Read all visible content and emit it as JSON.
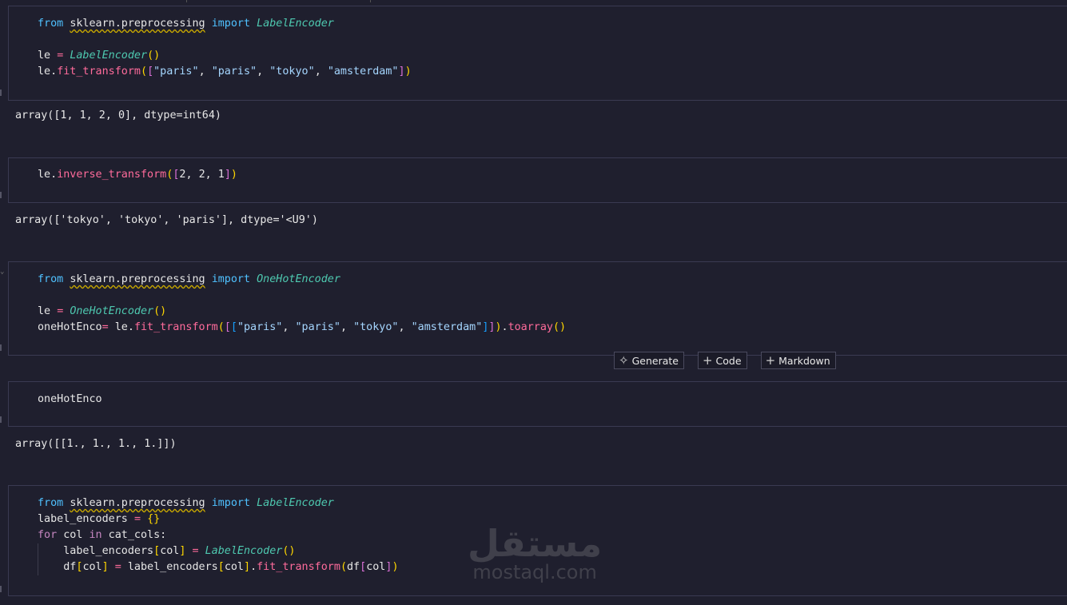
{
  "cells": [
    {
      "code": [
        [
          [
            "kw",
            "from"
          ],
          [
            "var",
            " "
          ],
          [
            "mod",
            "sklearn.preprocessing"
          ],
          [
            "var",
            " "
          ],
          [
            "kw",
            "import"
          ],
          [
            "var",
            " "
          ],
          [
            "cls",
            "LabelEncoder"
          ]
        ],
        [],
        [
          [
            "var",
            "le "
          ],
          [
            "op",
            "="
          ],
          [
            "var",
            " "
          ],
          [
            "cls",
            "LabelEncoder"
          ],
          [
            "br1",
            "()"
          ]
        ],
        [
          [
            "var",
            "le."
          ],
          [
            "fn",
            "fit_transform"
          ],
          [
            "br1",
            "("
          ],
          [
            "br2",
            "["
          ],
          [
            "str",
            "\"paris\""
          ],
          [
            "var",
            ", "
          ],
          [
            "str",
            "\"paris\""
          ],
          [
            "var",
            ", "
          ],
          [
            "str",
            "\"tokyo\""
          ],
          [
            "var",
            ", "
          ],
          [
            "str",
            "\"amsterdam\""
          ],
          [
            "br2",
            "]"
          ],
          [
            "br1",
            ")"
          ]
        ]
      ],
      "output": "array([1, 1, 2, 0], dtype=int64)"
    },
    {
      "code": [
        [
          [
            "var",
            "le."
          ],
          [
            "fn",
            "inverse_transform"
          ],
          [
            "br1",
            "("
          ],
          [
            "br2",
            "["
          ],
          [
            "num",
            "2"
          ],
          [
            "var",
            ", "
          ],
          [
            "num",
            "2"
          ],
          [
            "var",
            ", "
          ],
          [
            "num",
            "1"
          ],
          [
            "br2",
            "]"
          ],
          [
            "br1",
            ")"
          ]
        ]
      ],
      "output": "array(['tokyo', 'tokyo', 'paris'], dtype='<U9')"
    },
    {
      "code": [
        [
          [
            "kw",
            "from"
          ],
          [
            "var",
            " "
          ],
          [
            "mod",
            "sklearn.preprocessing"
          ],
          [
            "var",
            " "
          ],
          [
            "kw",
            "import"
          ],
          [
            "var",
            " "
          ],
          [
            "cls",
            "OneHotEncoder"
          ]
        ],
        [],
        [
          [
            "var",
            "le "
          ],
          [
            "op",
            "="
          ],
          [
            "var",
            " "
          ],
          [
            "cls",
            "OneHotEncoder"
          ],
          [
            "br1",
            "()"
          ]
        ],
        [
          [
            "var",
            "oneHotEnco"
          ],
          [
            "op",
            "="
          ],
          [
            "var",
            " le."
          ],
          [
            "fn",
            "fit_transform"
          ],
          [
            "br1",
            "("
          ],
          [
            "br2",
            "["
          ],
          [
            "br3",
            "["
          ],
          [
            "str",
            "\"paris\""
          ],
          [
            "var",
            ", "
          ],
          [
            "str",
            "\"paris\""
          ],
          [
            "var",
            ", "
          ],
          [
            "str",
            "\"tokyo\""
          ],
          [
            "var",
            ", "
          ],
          [
            "str",
            "\"amsterdam\""
          ],
          [
            "br3",
            "]"
          ],
          [
            "br2",
            "]"
          ],
          [
            "br1",
            ")"
          ],
          [
            "var",
            "."
          ],
          [
            "fn",
            "toarray"
          ],
          [
            "br1",
            "()"
          ]
        ]
      ],
      "output": ""
    },
    {
      "code": [
        [
          [
            "var",
            "oneHotEnco"
          ]
        ]
      ],
      "output": "array([[1., 1., 1., 1.]])"
    },
    {
      "code": [
        [
          [
            "kw",
            "from"
          ],
          [
            "var",
            " "
          ],
          [
            "mod",
            "sklearn.preprocessing"
          ],
          [
            "var",
            " "
          ],
          [
            "kw",
            "import"
          ],
          [
            "var",
            " "
          ],
          [
            "cls",
            "LabelEncoder"
          ]
        ],
        [
          [
            "var",
            "label_encoders "
          ],
          [
            "op",
            "="
          ],
          [
            "var",
            " "
          ],
          [
            "br1",
            "{}"
          ]
        ],
        [
          [
            "ctl",
            "for"
          ],
          [
            "var",
            " col "
          ],
          [
            "ctl",
            "in"
          ],
          [
            "var",
            " cat_cols:"
          ]
        ],
        [
          [
            "var",
            "    label_encoders"
          ],
          [
            "br1",
            "["
          ],
          [
            "var",
            "col"
          ],
          [
            "br1",
            "]"
          ],
          [
            "var",
            " "
          ],
          [
            "op",
            "="
          ],
          [
            "var",
            " "
          ],
          [
            "cls",
            "LabelEncoder"
          ],
          [
            "br1",
            "()"
          ]
        ],
        [
          [
            "var",
            "    df"
          ],
          [
            "br1",
            "["
          ],
          [
            "var",
            "col"
          ],
          [
            "br1",
            "]"
          ],
          [
            "var",
            " "
          ],
          [
            "op",
            "="
          ],
          [
            "var",
            " label_encoders"
          ],
          [
            "br1",
            "["
          ],
          [
            "var",
            "col"
          ],
          [
            "br1",
            "]"
          ],
          [
            "var",
            "."
          ],
          [
            "fn",
            "fit_transform"
          ],
          [
            "br1",
            "("
          ],
          [
            "var",
            "df"
          ],
          [
            "br2",
            "["
          ],
          [
            "var",
            "col"
          ],
          [
            "br2",
            "]"
          ],
          [
            "br1",
            ")"
          ]
        ]
      ],
      "output": ""
    }
  ],
  "toolbar": {
    "generate_label": "Generate",
    "code_label": "Code",
    "markdown_label": "Markdown",
    "generate_icon": "sparkle-icon",
    "code_icon": "plus-icon",
    "markdown_icon": "plus-icon"
  },
  "watermark": {
    "arabic": "مستقل",
    "latin": "mostaql.com"
  }
}
